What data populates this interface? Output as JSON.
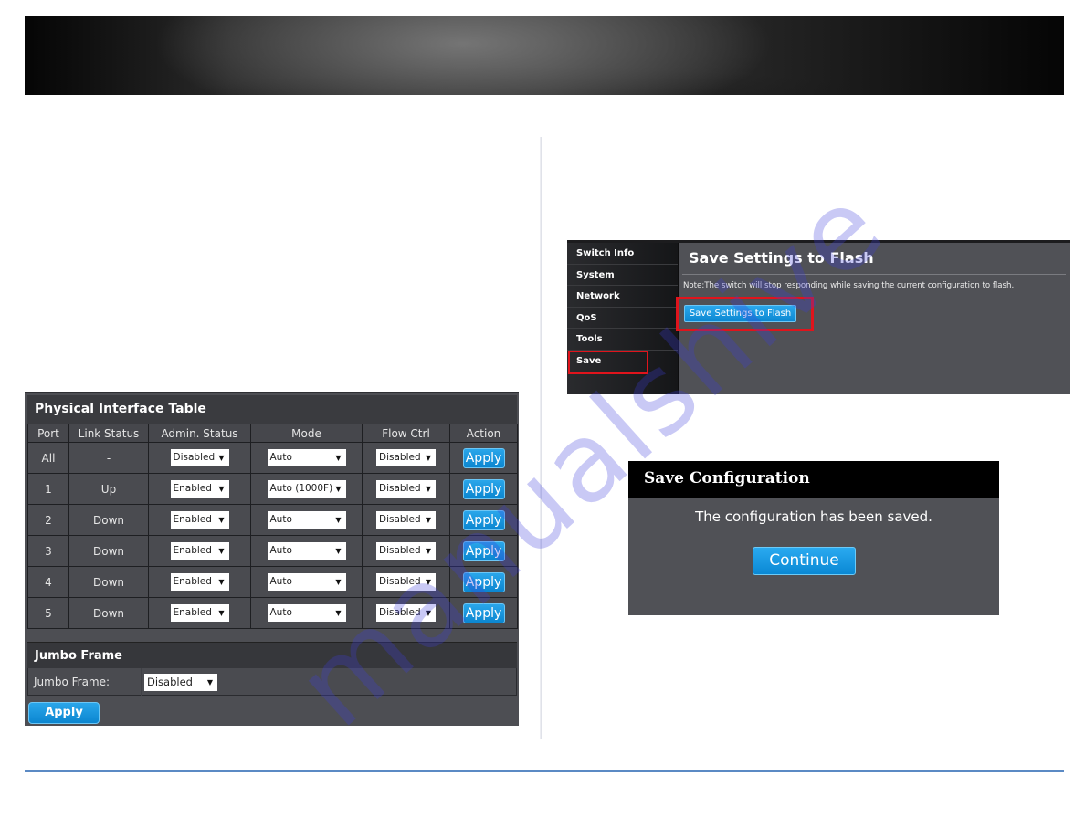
{
  "physical_interface": {
    "title": "Physical Interface Table",
    "columns": [
      "Port",
      "Link Status",
      "Admin. Status",
      "Mode",
      "Flow Ctrl",
      "Action"
    ],
    "rows": [
      {
        "port": "All",
        "link": "-",
        "admin": "Disabled",
        "mode": "Auto",
        "flow": "Disabled",
        "action": "Apply"
      },
      {
        "port": "1",
        "link": "Up",
        "admin": "Enabled",
        "mode": "Auto (1000F)",
        "flow": "Disabled",
        "action": "Apply"
      },
      {
        "port": "2",
        "link": "Down",
        "admin": "Enabled",
        "mode": "Auto",
        "flow": "Disabled",
        "action": "Apply"
      },
      {
        "port": "3",
        "link": "Down",
        "admin": "Enabled",
        "mode": "Auto",
        "flow": "Disabled",
        "action": "Apply"
      },
      {
        "port": "4",
        "link": "Down",
        "admin": "Enabled",
        "mode": "Auto",
        "flow": "Disabled",
        "action": "Apply"
      },
      {
        "port": "5",
        "link": "Down",
        "admin": "Enabled",
        "mode": "Auto",
        "flow": "Disabled",
        "action": "Apply"
      }
    ],
    "dropdown_arrow": "▼"
  },
  "jumbo_frame": {
    "title": "Jumbo Frame",
    "label": "Jumbo Frame:",
    "value": "Disabled",
    "apply_label": "Apply"
  },
  "flash": {
    "menu": [
      {
        "label": "Switch Info",
        "highlighted": false
      },
      {
        "label": "System",
        "highlighted": false
      },
      {
        "label": "Network",
        "highlighted": false
      },
      {
        "label": "QoS",
        "highlighted": false
      },
      {
        "label": "Tools",
        "highlighted": false
      },
      {
        "label": "Save",
        "highlighted": true
      }
    ],
    "title": "Save Settings to Flash",
    "note": "Note:The switch will stop responding while saving the current configuration to flash.",
    "button_label": "Save Settings to Flash"
  },
  "save_dialog": {
    "title": "Save Configuration",
    "message": "The configuration has been saved.",
    "button_label": "Continue"
  },
  "watermark": {
    "text": "manualshive"
  },
  "colors": {
    "button_blue": "#0b86d0",
    "highlight_red": "#e0141c",
    "panel_gray": "#4d4e53",
    "rule_blue": "#5b8ac4"
  }
}
